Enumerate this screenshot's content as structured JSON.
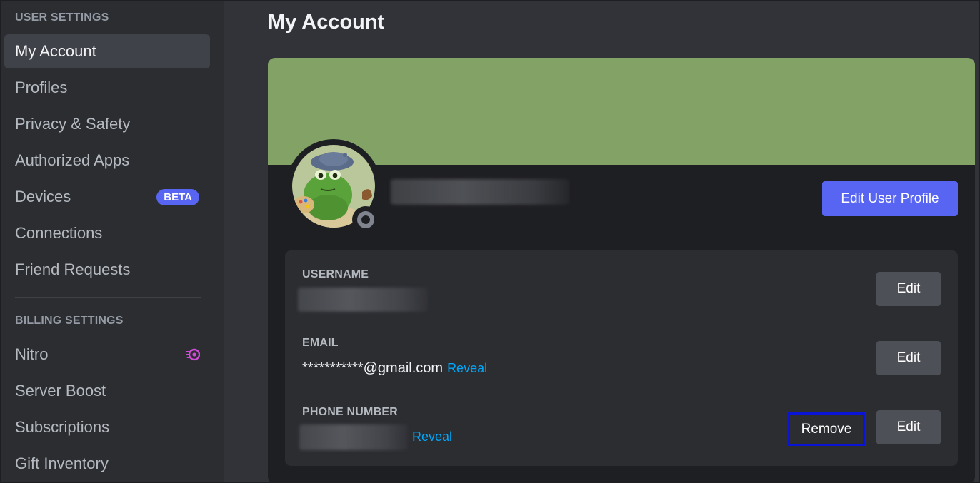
{
  "sidebar": {
    "user_settings_header": "USER SETTINGS",
    "user_items": [
      {
        "label": "My Account",
        "selected": true
      },
      {
        "label": "Profiles"
      },
      {
        "label": "Privacy & Safety"
      },
      {
        "label": "Authorized Apps"
      },
      {
        "label": "Devices",
        "badge": "BETA"
      },
      {
        "label": "Connections"
      },
      {
        "label": "Friend Requests"
      }
    ],
    "billing_settings_header": "BILLING SETTINGS",
    "billing_items": [
      {
        "label": "Nitro",
        "icon": "nitro-icon"
      },
      {
        "label": "Server Boost"
      },
      {
        "label": "Subscriptions"
      },
      {
        "label": "Gift Inventory"
      }
    ]
  },
  "main": {
    "title": "My Account",
    "banner_color": "#82a365",
    "edit_profile_label": "Edit User Profile",
    "fields": {
      "username": {
        "label": "USERNAME",
        "edit_label": "Edit"
      },
      "email": {
        "label": "EMAIL",
        "value": "***********@gmail.com",
        "reveal_label": "Reveal",
        "edit_label": "Edit"
      },
      "phone": {
        "label": "PHONE NUMBER",
        "reveal_label": "Reveal",
        "remove_label": "Remove",
        "edit_label": "Edit"
      }
    }
  },
  "colors": {
    "accent": "#5865f2",
    "link": "#00a8fc",
    "highlight_box": "#0a14d6"
  }
}
